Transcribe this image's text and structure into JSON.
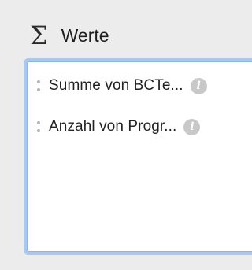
{
  "header": {
    "icon": "sigma-icon",
    "title": "Werte"
  },
  "values_well": {
    "items": [
      {
        "label": "Summe von BCTe...",
        "icon": "info-icon"
      },
      {
        "label": "Anzahl von Progr...",
        "icon": "info-icon"
      }
    ]
  },
  "colors": {
    "background": "#ececec",
    "well_border": "#a8c8ef",
    "info_icon": "#c8c8c8"
  }
}
